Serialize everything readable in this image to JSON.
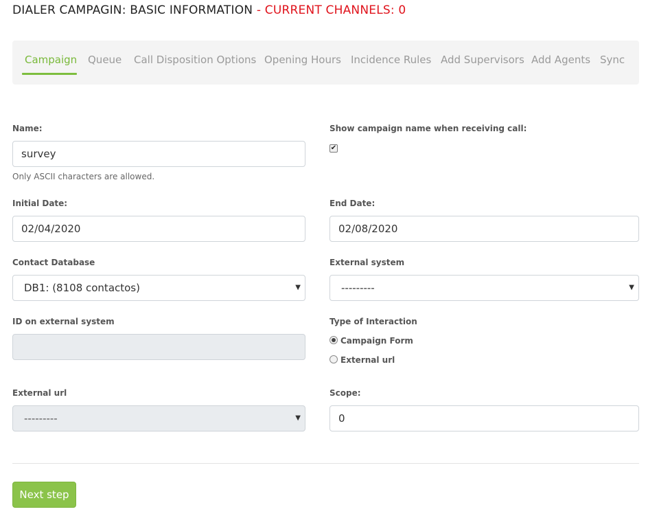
{
  "header": {
    "title": "DIALER CAMPAGIN: BASIC INFORMATION",
    "channels": "- CURRENT CHANNELS: 0"
  },
  "tabs": [
    {
      "label": "Campaign",
      "active": true
    },
    {
      "label": "Queue",
      "active": false
    },
    {
      "label": "Call Disposition Options",
      "active": false
    },
    {
      "label": "Opening Hours",
      "active": false
    },
    {
      "label": "Incidence Rules",
      "active": false
    },
    {
      "label": "Add Supervisors",
      "active": false
    },
    {
      "label": "Add Agents",
      "active": false
    },
    {
      "label": "Sync",
      "active": false
    }
  ],
  "form": {
    "name": {
      "label": "Name:",
      "value": "survey",
      "hint": "Only ASCII characters are allowed."
    },
    "show_name": {
      "label": "Show campaign name when receiving call:",
      "checked": true
    },
    "initial_date": {
      "label": "Initial Date:",
      "value": "02/04/2020"
    },
    "end_date": {
      "label": "End Date:",
      "value": "02/08/2020"
    },
    "contact_db": {
      "label": "Contact Database",
      "value": "DB1: (8108 contactos)"
    },
    "external_system": {
      "label": "External system",
      "value": "---------"
    },
    "external_id": {
      "label": "ID on external system",
      "value": ""
    },
    "interaction_type": {
      "label": "Type of Interaction",
      "options": [
        "Campaign Form",
        "External url"
      ],
      "selected": "Campaign Form"
    },
    "external_url": {
      "label": "External url",
      "value": "---------"
    },
    "scope": {
      "label": "Scope:",
      "value": "0"
    }
  },
  "actions": {
    "next_label": "Next step"
  },
  "colors": {
    "accent": "#7dbd3f",
    "alert": "#e0131c",
    "button": "#8bc34a"
  }
}
